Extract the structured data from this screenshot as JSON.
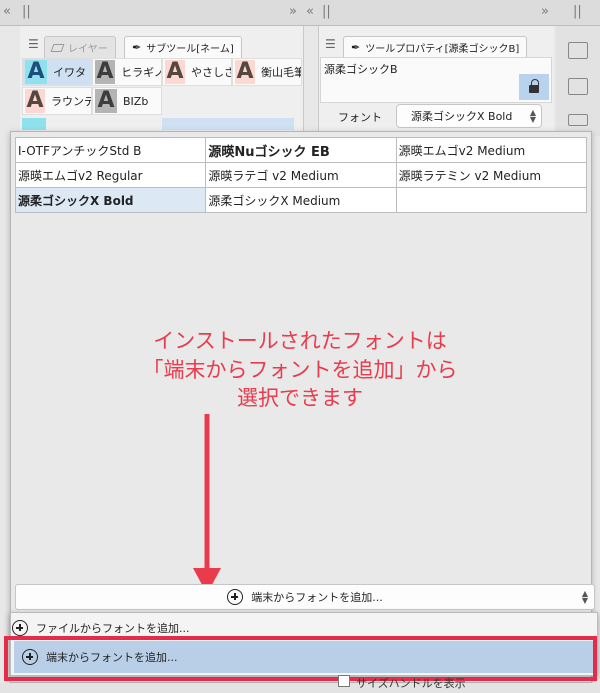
{
  "topbar": {
    "glyphs": [
      "«",
      "||",
      "»",
      "«",
      "||",
      "»",
      "||"
    ]
  },
  "sub_tool_panel": {
    "tabs": [
      {
        "label": "レイヤー",
        "active": false,
        "icon": "layer-icon"
      },
      {
        "label": "サブツール[ネーム]",
        "active": true,
        "icon": "pen-tool-icon"
      }
    ],
    "items": [
      {
        "label": "イワタ",
        "icon_letter": "A",
        "icon_style": "cyan",
        "selected": true
      },
      {
        "label": "ヒラギノ",
        "icon_letter": "A",
        "icon_style": "gray",
        "selected": false
      },
      {
        "label": "やさしさ",
        "icon_letter": "A",
        "icon_style": "pink",
        "selected": false
      },
      {
        "label": "衡山毛筆",
        "icon_letter": "A",
        "icon_style": "pink",
        "selected": false
      },
      {
        "label": "ラウンデ",
        "icon_letter": "A",
        "icon_style": "pink",
        "selected": false
      },
      {
        "label": "BIZb",
        "icon_letter": "A",
        "icon_style": "gray",
        "selected": false
      }
    ]
  },
  "tool_property": {
    "tab_label": "ツールプロパティ[源柔ゴシックB]",
    "preset_name": "源柔ゴシックB",
    "font_label": "フォント",
    "font_value": "源柔ゴシックX Bold"
  },
  "font_list": {
    "rows": [
      [
        {
          "text": "I-OTFアンチックStd B",
          "style": "normal"
        },
        {
          "text": "源暎Nuゴシック EB",
          "style": "bold"
        },
        {
          "text": "源暎エムゴv2 Medium",
          "style": "normal"
        }
      ],
      [
        {
          "text": "源暎エムゴv2 Regular",
          "style": "normal"
        },
        {
          "text": "源暎ラテゴ v2 Medium",
          "style": "normal"
        },
        {
          "text": "源暎ラテミン v2 Medium",
          "style": "normal"
        }
      ],
      [
        {
          "text": "源柔ゴシックX Bold",
          "style": "selected"
        },
        {
          "text": "源柔ゴシックX Medium",
          "style": "normal"
        },
        {
          "text": "",
          "style": "normal"
        }
      ]
    ],
    "add_select_label": "端末からフォントを追加..."
  },
  "annotation": {
    "lines": [
      "インストールされたフォントは",
      "「端末からフォントを追加」から",
      "選択できます"
    ],
    "color": "#ea3b4d"
  },
  "add_menu": {
    "items": [
      {
        "label": "ファイルからフォントを追加..."
      },
      {
        "label": "端末からフォントを追加..."
      }
    ],
    "highlight_color": "#e52a4a"
  },
  "bottom": {
    "checkbox_label": "サイズハンドルを表示"
  }
}
